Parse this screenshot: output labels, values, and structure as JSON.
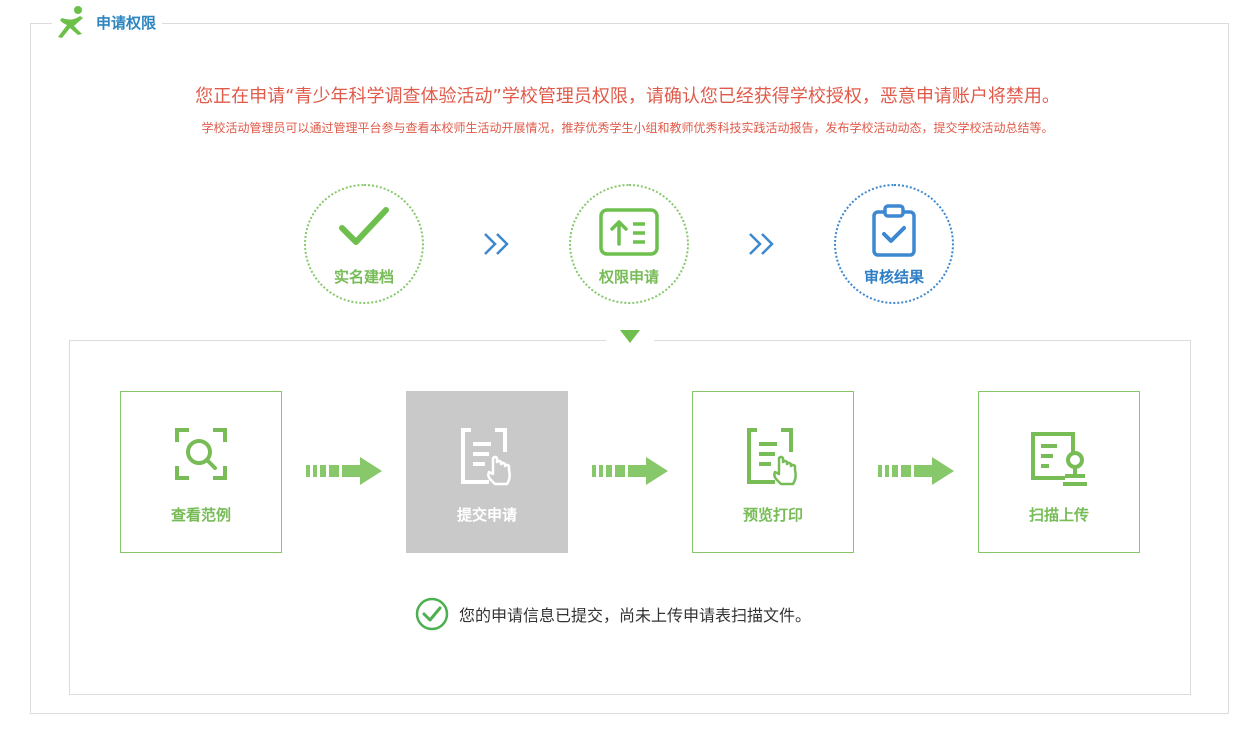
{
  "section": {
    "title": "申请权限",
    "logo_icon": "running-person-icon"
  },
  "notice": {
    "main": "您正在申请“青少年科学调查体验活动”学校管理员权限，请确认您已经获得学校授权，恶意申请账户将禁用。",
    "sub": "学校活动管理员可以通过管理平台参与查看本校师生活动开展情况，推荐优秀学生小组和教师优秀科技实践活动报告，发布学校活动动态，提交学校活动总结等。"
  },
  "stages": [
    {
      "label": "实名建档",
      "icon": "checkmark-icon",
      "state": "done"
    },
    {
      "label": "权限申请",
      "icon": "upload-list-icon",
      "state": "done"
    },
    {
      "label": "审核结果",
      "icon": "clipboard-check-icon",
      "state": "current"
    }
  ],
  "steps": [
    {
      "label": "查看范例",
      "icon": "search-scan-icon",
      "active": false
    },
    {
      "label": "提交申请",
      "icon": "document-hand-icon",
      "active": true
    },
    {
      "label": "预览打印",
      "icon": "document-hand-icon",
      "active": false
    },
    {
      "label": "扫描上传",
      "icon": "document-stamp-icon",
      "active": false
    }
  ],
  "status": {
    "text": "您的申请信息已提交，尚未上传申请表扫描文件。",
    "icon": "check-circle-icon"
  },
  "colors": {
    "green": "#78bc58",
    "blue": "#2f7fc6",
    "red": "#e05a4a",
    "gray": "#c9c9c9"
  }
}
